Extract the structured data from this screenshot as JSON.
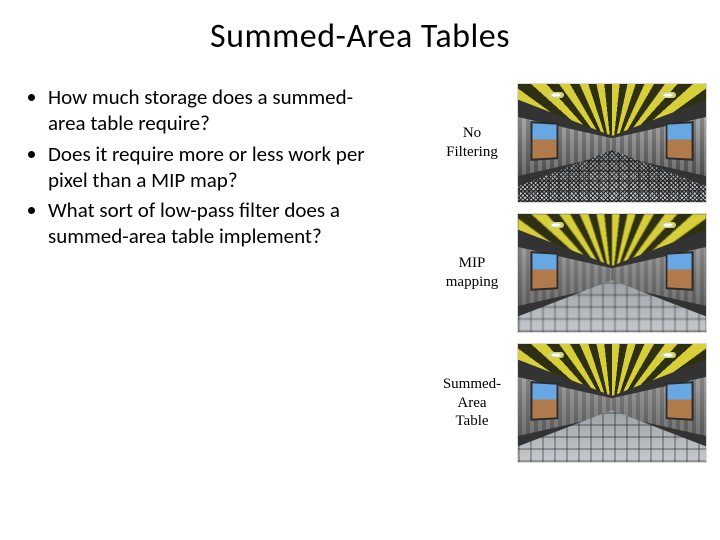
{
  "title": "Summed-Area Tables",
  "bullets": [
    "How much storage does a summed-area table require?",
    "Does it require more or less work per pixel than a MIP map?",
    "What sort of low-pass filter does a summed-area table implement?"
  ],
  "rows": [
    {
      "label_line1": "No",
      "label_line2": "Filtering",
      "variant": "nofilter"
    },
    {
      "label_line1": "MIP",
      "label_line2": "mapping",
      "variant": "mip"
    },
    {
      "label_line1": "Summed-",
      "label_line2": "Area",
      "label_line3": "Table",
      "variant": "sat"
    }
  ]
}
